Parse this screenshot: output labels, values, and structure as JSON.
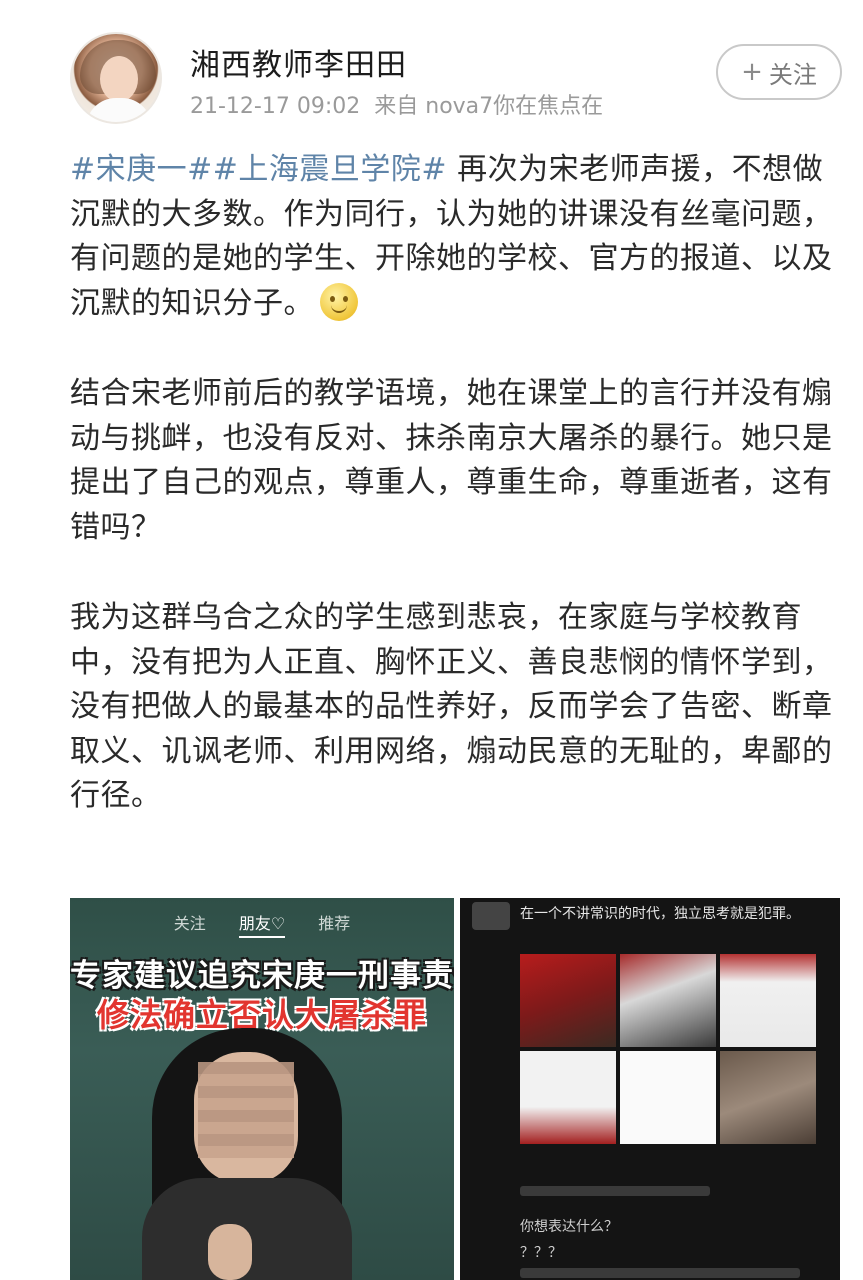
{
  "user": {
    "name": "湘西教师李田田",
    "timestamp": "21-12-17 09:02",
    "source": "来自 nova7你在焦点在",
    "follow_label": "关注",
    "follow_icon": "plus-icon"
  },
  "post": {
    "paragraph1": {
      "hashtags": "#宋庚一##上海震旦学院#",
      "text": " 再次为宋老师声援，不想做沉默的大多数。作为同行，认为她的讲课没有丝毫问题，有问题的是她的学生、开除她的学校、官方的报道、以及沉默的知识分子。",
      "emoji": "smile-emoji"
    },
    "paragraph2": "结合宋老师前后的教学语境，她在课堂上的言行并没有煽动与挑衅，也没有反对、抹杀南京大屠杀的暴行。她只是提出了自己的观点，尊重人，尊重生命，尊重逝者，这有错吗？",
    "paragraph3": "我为这群乌合之众的学生感到悲哀，在家庭与学校教育中，没有把为人正直、胸怀正义、善良悲悯的情怀学到，没有把做人的最基本的品性养好，反而学会了告密、断章取义、讥讽老师、利用网络，煽动民意的无耻的，卑鄙的行径。"
  },
  "images": {
    "image1": {
      "tabs": [
        "关注",
        "朋友♡",
        "推荐"
      ],
      "caption_line1": "专家建议追究宋庚一刑事责任",
      "caption_line2": "修法确立否认大屠杀罪"
    },
    "image2": {
      "title": "在一个不讲常识的时代，独立思考就是犯罪。",
      "comment1": "你想表达什么？",
      "comment2": "？？？"
    }
  },
  "colors": {
    "hashtag": "#5f84a8",
    "caption_red": "#e2352f",
    "meta_gray": "#9a9a9a"
  }
}
